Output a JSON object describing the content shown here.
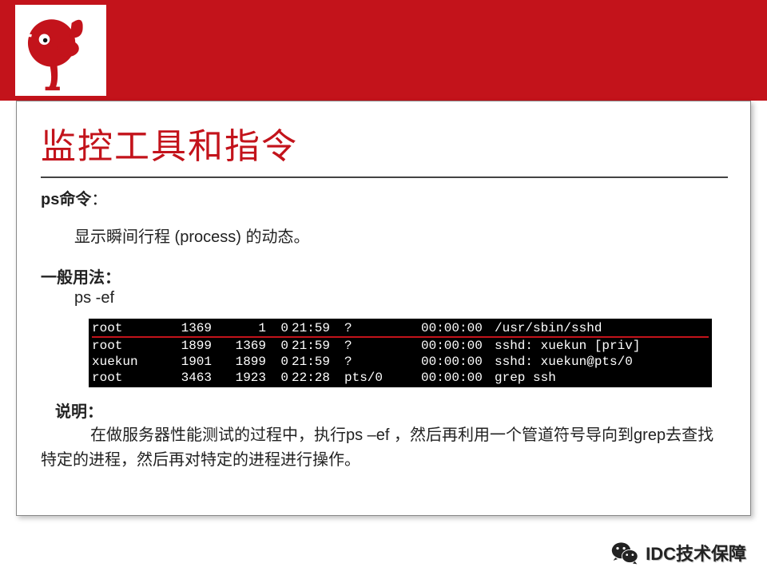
{
  "title": "监控工具和指令",
  "section1": {
    "heading": "ps命令",
    "colon": "：",
    "desc": "显示瞬间行程 (process) 的动态。"
  },
  "section2": {
    "heading": "一般用法",
    "colon": "：",
    "cmd": "ps  -ef"
  },
  "terminal": {
    "rows": [
      {
        "user": "root",
        "pid": "1369",
        "ppid": "1",
        "c": "0",
        "stime": "21:59",
        "tty": "?",
        "time": "00:00:00",
        "cmd": "/usr/sbin/sshd"
      },
      {
        "user": "root",
        "pid": "1899",
        "ppid": "1369",
        "c": "0",
        "stime": "21:59",
        "tty": "?",
        "time": "00:00:00",
        "cmd": "sshd: xuekun [priv]"
      },
      {
        "user": "xuekun",
        "pid": "1901",
        "ppid": "1899",
        "c": "0",
        "stime": "21:59",
        "tty": "?",
        "time": "00:00:00",
        "cmd": "sshd: xuekun@pts/0"
      },
      {
        "user": "root",
        "pid": "3463",
        "ppid": "1923",
        "c": "0",
        "stime": "22:28",
        "tty": "pts/0",
        "time": "00:00:00",
        "cmd": "grep ssh"
      }
    ]
  },
  "note": {
    "heading": "说明",
    "colon": "：",
    "body": "在做服务器性能测试的过程中，执行ps –ef ，然后再利用一个管道符号导向到grep去查找特定的进程，然后再对特定的进程进行操作。"
  },
  "footer": {
    "text": "IDC技术保障"
  }
}
